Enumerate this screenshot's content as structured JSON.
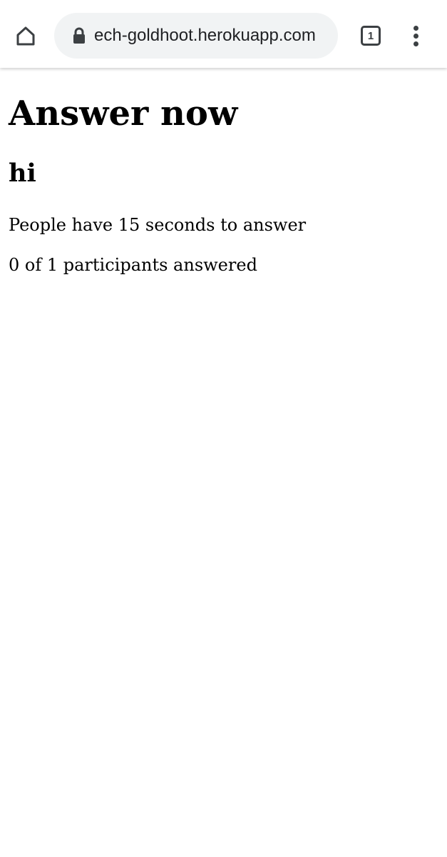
{
  "browser": {
    "url": "ech-goldhoot.herokuapp.com",
    "tab_count": "1",
    "icons": {
      "home": "home-icon",
      "lock": "lock-icon",
      "tabs": "tab-switcher-icon",
      "menu": "overflow-menu-icon"
    }
  },
  "page": {
    "title": "Answer now",
    "question": "hi",
    "timer_text": "People have 15 seconds to answer",
    "participants_text": "0 of 1 participants answered"
  }
}
